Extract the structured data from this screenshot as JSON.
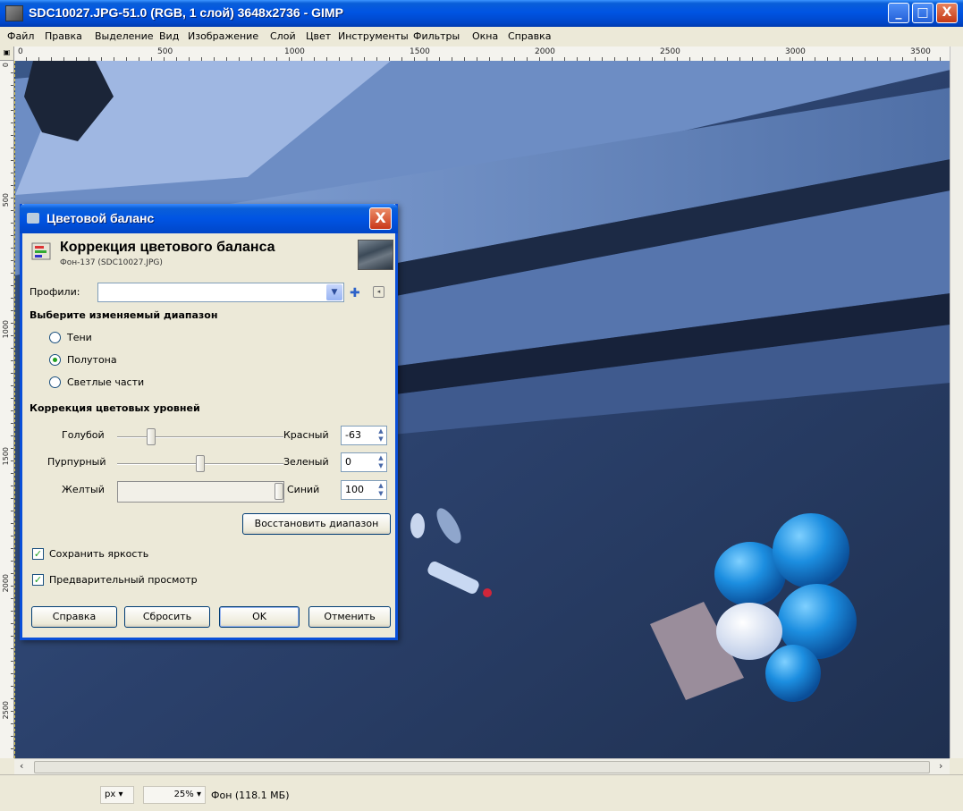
{
  "window": {
    "title": "SDC10027.JPG-51.0 (RGB, 1 слой) 3648x2736 - GIMP",
    "controls": {
      "minimize": "_",
      "maximize": "□",
      "close": "X"
    }
  },
  "menubar": [
    "Файл",
    "Правка",
    "Выделение",
    "Вид",
    "Изображение",
    "Слой",
    "Цвет",
    "Инструменты",
    "Фильтры",
    "Окна",
    "Справка"
  ],
  "ruler_top_labels": [
    "0",
    "500",
    "1000",
    "1500",
    "2000",
    "2500",
    "3000",
    "3500"
  ],
  "ruler_left_labels": [
    "0",
    "500",
    "1000",
    "1500",
    "2000",
    "2500"
  ],
  "dialog": {
    "title": "Цветовой баланс",
    "close": "X",
    "header_title": "Коррекция цветового баланса",
    "header_subtitle": "Фон-137 (SDC10027.JPG)",
    "profiles_label": "Профили:",
    "profiles_value": "",
    "range_heading": "Выберите изменяемый диапазон",
    "ranges": [
      {
        "label": "Тени",
        "selected": false
      },
      {
        "label": "Полутона",
        "selected": true
      },
      {
        "label": "Светлые части",
        "selected": false
      }
    ],
    "levels_heading": "Коррекция цветовых уровней",
    "sliders": [
      {
        "left": "Голубой",
        "right": "Красный",
        "value": "-63",
        "level": -63
      },
      {
        "left": "Пурпурный",
        "right": "Зеленый",
        "value": "0",
        "level": 0
      },
      {
        "left": "Желтый",
        "right": "Синий",
        "value": "100",
        "level": 100
      }
    ],
    "reset_range_button": "Восстановить диапазон",
    "preserve_luminosity": {
      "label": "Сохранить яркость",
      "checked": true
    },
    "preview": {
      "label": "Предварительный просмотр",
      "checked": true
    },
    "buttons": {
      "help": "Справка",
      "reset": "Сбросить",
      "ok": "OK",
      "cancel": "Отменить"
    }
  },
  "status": {
    "unit": "px",
    "zoom": "25%",
    "layer_info": "Фон (118.1 МБ)"
  }
}
